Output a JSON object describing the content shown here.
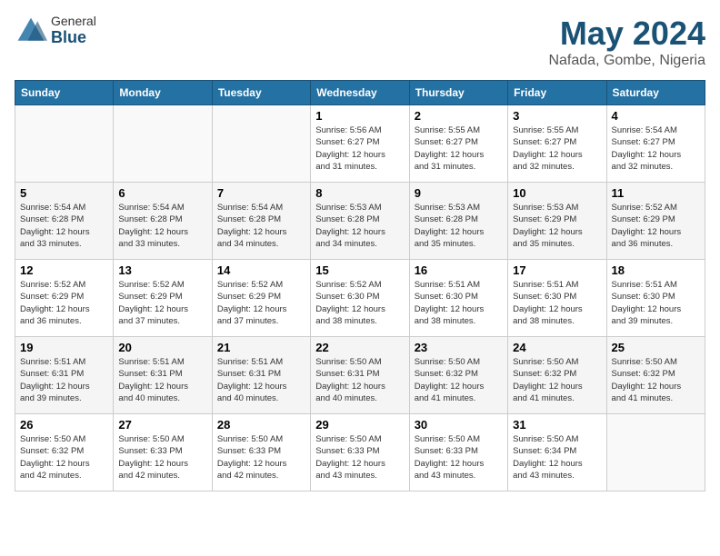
{
  "logo": {
    "general": "General",
    "blue": "Blue"
  },
  "header": {
    "month": "May 2024",
    "location": "Nafada, Gombe, Nigeria"
  },
  "weekdays": [
    "Sunday",
    "Monday",
    "Tuesday",
    "Wednesday",
    "Thursday",
    "Friday",
    "Saturday"
  ],
  "weeks": [
    [
      {
        "day": "",
        "info": ""
      },
      {
        "day": "",
        "info": ""
      },
      {
        "day": "",
        "info": ""
      },
      {
        "day": "1",
        "info": "Sunrise: 5:56 AM\nSunset: 6:27 PM\nDaylight: 12 hours\nand 31 minutes."
      },
      {
        "day": "2",
        "info": "Sunrise: 5:55 AM\nSunset: 6:27 PM\nDaylight: 12 hours\nand 31 minutes."
      },
      {
        "day": "3",
        "info": "Sunrise: 5:55 AM\nSunset: 6:27 PM\nDaylight: 12 hours\nand 32 minutes."
      },
      {
        "day": "4",
        "info": "Sunrise: 5:54 AM\nSunset: 6:27 PM\nDaylight: 12 hours\nand 32 minutes."
      }
    ],
    [
      {
        "day": "5",
        "info": "Sunrise: 5:54 AM\nSunset: 6:28 PM\nDaylight: 12 hours\nand 33 minutes."
      },
      {
        "day": "6",
        "info": "Sunrise: 5:54 AM\nSunset: 6:28 PM\nDaylight: 12 hours\nand 33 minutes."
      },
      {
        "day": "7",
        "info": "Sunrise: 5:54 AM\nSunset: 6:28 PM\nDaylight: 12 hours\nand 34 minutes."
      },
      {
        "day": "8",
        "info": "Sunrise: 5:53 AM\nSunset: 6:28 PM\nDaylight: 12 hours\nand 34 minutes."
      },
      {
        "day": "9",
        "info": "Sunrise: 5:53 AM\nSunset: 6:28 PM\nDaylight: 12 hours\nand 35 minutes."
      },
      {
        "day": "10",
        "info": "Sunrise: 5:53 AM\nSunset: 6:29 PM\nDaylight: 12 hours\nand 35 minutes."
      },
      {
        "day": "11",
        "info": "Sunrise: 5:52 AM\nSunset: 6:29 PM\nDaylight: 12 hours\nand 36 minutes."
      }
    ],
    [
      {
        "day": "12",
        "info": "Sunrise: 5:52 AM\nSunset: 6:29 PM\nDaylight: 12 hours\nand 36 minutes."
      },
      {
        "day": "13",
        "info": "Sunrise: 5:52 AM\nSunset: 6:29 PM\nDaylight: 12 hours\nand 37 minutes."
      },
      {
        "day": "14",
        "info": "Sunrise: 5:52 AM\nSunset: 6:29 PM\nDaylight: 12 hours\nand 37 minutes."
      },
      {
        "day": "15",
        "info": "Sunrise: 5:52 AM\nSunset: 6:30 PM\nDaylight: 12 hours\nand 38 minutes."
      },
      {
        "day": "16",
        "info": "Sunrise: 5:51 AM\nSunset: 6:30 PM\nDaylight: 12 hours\nand 38 minutes."
      },
      {
        "day": "17",
        "info": "Sunrise: 5:51 AM\nSunset: 6:30 PM\nDaylight: 12 hours\nand 38 minutes."
      },
      {
        "day": "18",
        "info": "Sunrise: 5:51 AM\nSunset: 6:30 PM\nDaylight: 12 hours\nand 39 minutes."
      }
    ],
    [
      {
        "day": "19",
        "info": "Sunrise: 5:51 AM\nSunset: 6:31 PM\nDaylight: 12 hours\nand 39 minutes."
      },
      {
        "day": "20",
        "info": "Sunrise: 5:51 AM\nSunset: 6:31 PM\nDaylight: 12 hours\nand 40 minutes."
      },
      {
        "day": "21",
        "info": "Sunrise: 5:51 AM\nSunset: 6:31 PM\nDaylight: 12 hours\nand 40 minutes."
      },
      {
        "day": "22",
        "info": "Sunrise: 5:50 AM\nSunset: 6:31 PM\nDaylight: 12 hours\nand 40 minutes."
      },
      {
        "day": "23",
        "info": "Sunrise: 5:50 AM\nSunset: 6:32 PM\nDaylight: 12 hours\nand 41 minutes."
      },
      {
        "day": "24",
        "info": "Sunrise: 5:50 AM\nSunset: 6:32 PM\nDaylight: 12 hours\nand 41 minutes."
      },
      {
        "day": "25",
        "info": "Sunrise: 5:50 AM\nSunset: 6:32 PM\nDaylight: 12 hours\nand 41 minutes."
      }
    ],
    [
      {
        "day": "26",
        "info": "Sunrise: 5:50 AM\nSunset: 6:32 PM\nDaylight: 12 hours\nand 42 minutes."
      },
      {
        "day": "27",
        "info": "Sunrise: 5:50 AM\nSunset: 6:33 PM\nDaylight: 12 hours\nand 42 minutes."
      },
      {
        "day": "28",
        "info": "Sunrise: 5:50 AM\nSunset: 6:33 PM\nDaylight: 12 hours\nand 42 minutes."
      },
      {
        "day": "29",
        "info": "Sunrise: 5:50 AM\nSunset: 6:33 PM\nDaylight: 12 hours\nand 43 minutes."
      },
      {
        "day": "30",
        "info": "Sunrise: 5:50 AM\nSunset: 6:33 PM\nDaylight: 12 hours\nand 43 minutes."
      },
      {
        "day": "31",
        "info": "Sunrise: 5:50 AM\nSunset: 6:34 PM\nDaylight: 12 hours\nand 43 minutes."
      },
      {
        "day": "",
        "info": ""
      }
    ]
  ]
}
